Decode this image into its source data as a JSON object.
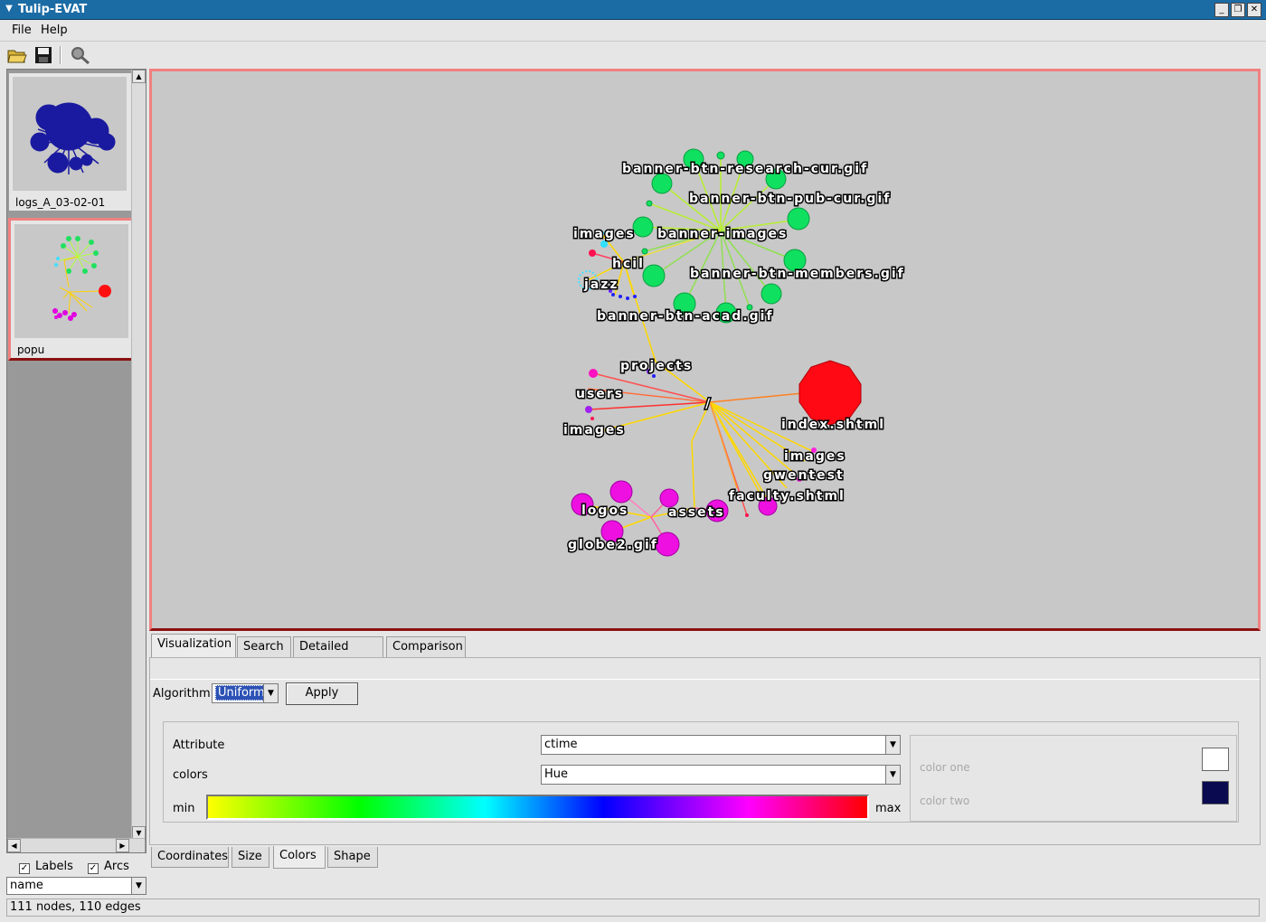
{
  "window": {
    "title": "Tulip-EVAT"
  },
  "menu": {
    "file": "File",
    "help": "Help"
  },
  "toolbar": {
    "open_icon": "folder-open-icon",
    "save_icon": "save-icon",
    "find_icon": "magnifier-icon"
  },
  "thumbnails": [
    {
      "label": "logs_A_03-02-01",
      "color": "#1a1aa0"
    },
    {
      "label": "popu"
    }
  ],
  "left_controls": {
    "labels_checkbox": {
      "label": "Labels",
      "checked": true
    },
    "arcs_checkbox": {
      "label": "Arcs",
      "checked": true
    },
    "property_select": "name"
  },
  "graph": {
    "labels": [
      "banner-btn-research-cur.gif",
      "banner-btn-pub-cur.gif",
      "banner-images",
      "images",
      "hcil",
      "jazz",
      "banner-btn-members.gif",
      "banner-btn-acad.gif",
      "projects",
      "users",
      "images",
      "/",
      "index.shtml",
      "images",
      "gwentest",
      "faculty.shtml",
      "logos",
      "assets",
      "globe2.gif"
    ]
  },
  "tabs_top": [
    "Visualization",
    "Search",
    "Detailed Data",
    "Comparison"
  ],
  "visualization": {
    "algorithm_label": "Algorithm",
    "algorithm_value": "Uniform",
    "apply_label": "Apply",
    "attribute_label": "Attribute",
    "attribute_value": "ctime",
    "colors_label": "colors",
    "colors_value": "Hue",
    "min_label": "min",
    "max_label": "max",
    "color_one_label": "color one",
    "color_two_label": "color two",
    "color_one": "#ffffff",
    "color_two": "#0a0a50"
  },
  "tabs_bottom": [
    "Coordinates",
    "Size",
    "Colors",
    "Shape"
  ],
  "status": "111 nodes, 110 edges"
}
